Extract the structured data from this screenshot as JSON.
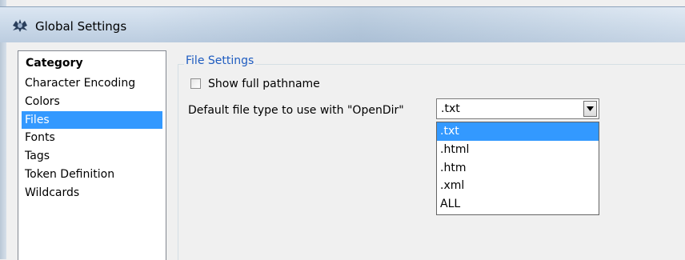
{
  "window": {
    "title": "Global Settings",
    "icon": "app-gear-icon"
  },
  "category": {
    "header": "Category",
    "items": [
      {
        "label": "Character Encoding",
        "selected": false
      },
      {
        "label": "Colors",
        "selected": false
      },
      {
        "label": "Files",
        "selected": true
      },
      {
        "label": "Fonts",
        "selected": false
      },
      {
        "label": "Tags",
        "selected": false
      },
      {
        "label": "Token Definition",
        "selected": false
      },
      {
        "label": "Wildcards",
        "selected": false
      }
    ]
  },
  "file_settings": {
    "legend": "File Settings",
    "show_full_pathname": {
      "label": "Show full pathname",
      "checked": false
    },
    "default_type_label": "Default file type to use with \"OpenDir\"",
    "default_type_value": ".txt",
    "options": [
      {
        "label": ".txt",
        "selected": true
      },
      {
        "label": ".html",
        "selected": false
      },
      {
        "label": ".htm",
        "selected": false
      },
      {
        "label": ".xml",
        "selected": false
      },
      {
        "label": "ALL",
        "selected": false
      }
    ]
  },
  "colors": {
    "selection": "#3399ff",
    "legend_text": "#1e5cc0"
  }
}
